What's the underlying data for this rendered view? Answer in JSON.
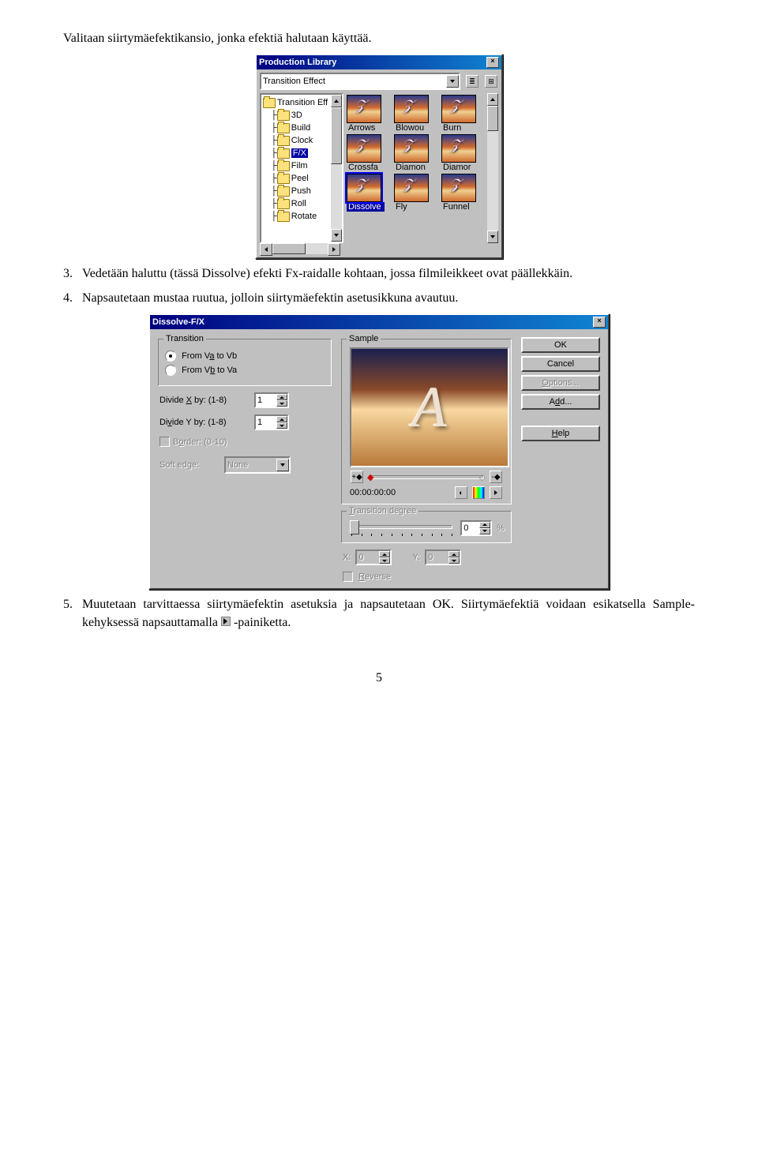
{
  "doc": {
    "intro": "Valitaan siirtymäefektikansio, jonka efektiä halutaan käyttää.",
    "step3": "Vedetään haluttu (tässä Dissolve) efekti Fx-raidalle kohtaan, jossa filmileikkeet ovat päällekkäin.",
    "step3_num": "3.",
    "step4": "Napsautetaan mustaa ruutua, jolloin siirtymäefektin asetusikkuna avautuu.",
    "step4_num": "4.",
    "step5a": "Muutetaan tarvittaessa siirtymäefektin asetuksia ja napsautetaan OK. Siirtymäefektiä voidaan esikatsella Sample-kehyksessä napsauttamalla ",
    "step5b": " -painiketta.",
    "step5_num": "5.",
    "page": "5"
  },
  "library": {
    "title": "Production Library",
    "dropdown": "Transition Effect",
    "tree": [
      "Transition Eff",
      "3D",
      "Build",
      "Clock",
      "F/X",
      "Film",
      "Peel",
      "Push",
      "Roll",
      "Rotate"
    ],
    "tree_selected": 4,
    "thumbs": [
      "Arrows",
      "Blowou",
      "Burn",
      "Crossfa",
      "Diamon",
      "Diamor",
      "Dissolve",
      "Fly",
      "Funnel"
    ],
    "thumb_selected": 6
  },
  "dialog": {
    "title": "Dissolve-F/X",
    "groups": {
      "transition": "Transition",
      "sample": "Sample",
      "degree": "Transition degree"
    },
    "radios": {
      "a": "From Va to Vb",
      "b": "From Vb to Va"
    },
    "labels": {
      "divx": "Divide X by: (1-8)",
      "divy": "Divide Y by: (1-8)",
      "border": "Border: (0-10)",
      "soft": "Soft edge:",
      "reverse": "Reverse",
      "x": "X:",
      "y": "Y:"
    },
    "values": {
      "divx": "1",
      "divy": "1",
      "soft": "None",
      "timecode": "00:00:00:00",
      "degree": "0",
      "percent": "%",
      "x": "0",
      "y": "0"
    },
    "buttons": {
      "ok": "OK",
      "cancel": "Cancel",
      "options": "Options...",
      "add": "Add...",
      "help": "Help"
    }
  }
}
